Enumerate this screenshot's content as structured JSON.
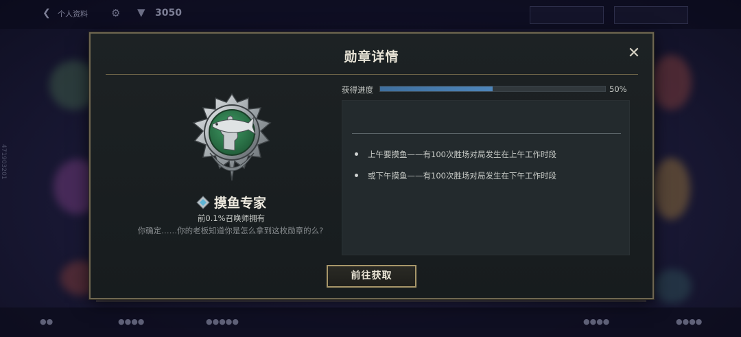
{
  "background": {
    "header_title": "个人资料",
    "currency_value": "3050",
    "side_id": "471903201"
  },
  "dialog": {
    "title": "勋章详情",
    "close_icon": "close-icon"
  },
  "badge": {
    "name": "摸鱼专家",
    "owner_text": "前0.1%召唤师拥有",
    "description": "你确定……你的老板知道你是怎么拿到这枚勋章的么?",
    "icon": "fish-fist-medal-icon",
    "rank_icon": "diamond-rank-icon"
  },
  "progress": {
    "label": "获得进度",
    "value_text": "50%",
    "fraction": 0.5,
    "fill_color": "#4e86bb"
  },
  "conditions": [
    "上午要摸鱼——有100次胜场对局发生在上午工作时段",
    "或下午摸鱼——有100次胜场对局发生在下午工作时段"
  ],
  "action": {
    "go_label": "前往获取"
  },
  "colors": {
    "accent_gold": "#a8976a",
    "medal_green": "#2f7a4e"
  }
}
